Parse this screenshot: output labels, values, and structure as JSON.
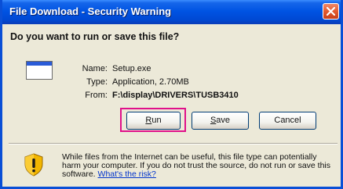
{
  "window": {
    "title": "File Download - Security Warning"
  },
  "dialog": {
    "question": "Do you want to run or save this file?",
    "fields": [
      {
        "label": "Name:",
        "value": "Setup.exe"
      },
      {
        "label": "Type:",
        "value": "Application, 2.70MB"
      },
      {
        "label": "From:",
        "value": "F:\\display\\DRIVERS\\TUSB3410"
      }
    ]
  },
  "buttons": {
    "run": "Run",
    "save": "Save",
    "cancel": "Cancel"
  },
  "warning": {
    "text": "While files from the Internet can be useful, this file type can potentially harm your computer. If you do not trust the source, do not run or save this software.",
    "link": "What's the risk?"
  },
  "colors": {
    "titlebar": "#0054e3",
    "highlight": "#e0108a",
    "link": "#0033cc"
  },
  "icons": {
    "file": "application-window-icon",
    "shield": "security-shield-icon",
    "close": "close-icon"
  }
}
